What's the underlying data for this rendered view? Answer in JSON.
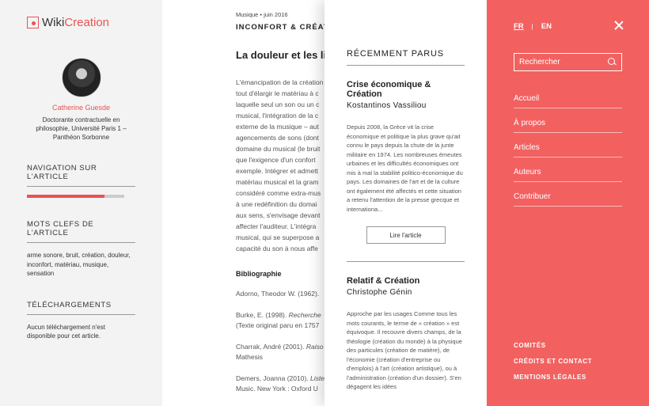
{
  "sidebar": {
    "logo": {
      "word1": "Wiki",
      "word2": "Creation"
    },
    "author": {
      "name": "Catherine Guesde",
      "description": "Doctorante contractuelle en philosophie, Université Paris 1 – Panthéon Sorbonne"
    },
    "navigation_title": "NAVIGATION SUR L'ARTICLE",
    "reading_progress": 0.8,
    "keywords_title": "MOTS CLEFS DE L'ARTICLE",
    "keywords": "arme sonore, bruit, création, douleur, inconfort, matériau, musique, sensation",
    "downloads_title": "TÉLÉCHARGEMENTS",
    "downloads_text": "Aucun téléchargement n'est disponible pour cet article."
  },
  "article": {
    "meta": "Musique • juin 2016",
    "rubric": "INCONFORT & CRÉATION",
    "title": "La douleur et les limites",
    "body": [
      "L'émancipation de la création",
      "tout d'élargir le matériau à c",
      "laquelle seul un son ou un c",
      "musical, l'intégration de la c",
      "externe de la musique – aut",
      "agencements de sons (dont",
      "domaine du musical (le bruit",
      "que l'exigence d'un confort",
      "exemple. Intégrer et admett",
      "matériau musical et la gram",
      "considéré comme extra-mus",
      "à une redéfinition du domai",
      "aux sens, s'envisage devant",
      "affecter l'auditeur. L'intégra",
      "musical, qui se superpose a",
      "capacité du son à nous affe"
    ],
    "bibliography_title": "Bibliographie",
    "references": [
      {
        "text": "Adorno, Theodor W. (1962).",
        "italic": "",
        "rest": ""
      },
      {
        "text": "Burke, E. (1998). ",
        "italic": "Recherche",
        "rest": "(Texte original paru en 1757"
      },
      {
        "text": "Charrak, André (2001). ",
        "italic": "Raiso",
        "rest": "Mathesis"
      },
      {
        "text": "Demers, Joanna (2010). ",
        "italic": "Liste",
        "rest": "Music. New York : Oxford U"
      }
    ]
  },
  "recent": {
    "heading": "RÉCEMMENT PARUS",
    "cards": [
      {
        "title": "Crise économique & Création",
        "author": "Kostantinos Vassiliou",
        "excerpt": "Depuis 2008, la Grèce vit la crise économique et politique la plus grave qu'ait connu le pays depuis la chute de la junte militaire en 1974. Les nombreuses émeutes urbaines et les difficultés économiques ont mis à mal la stabilité politico-économique du pays. Les domaines de l'art et de la culture ont également été affectés et cette situation a retenu l'attention de la presse grecque et internationa...",
        "button": "Lire l'article"
      },
      {
        "title": "Relatif & Création",
        "author": "Christophe Génin",
        "excerpt": "Approche par les usages Comme tous les mots courants, le terme de « création » est équivoque. Il recouvre divers champs, de la théologie (création du monde) à la physique des particules (création de matière), de l'économie (création d'entreprise ou d'emplois) à l'art (création artistique), ou à l'administration (création d'un dossier). S'en dégagent les idées"
      }
    ]
  },
  "menu": {
    "lang_fr": "FR",
    "lang_sep": "|",
    "lang_en": "EN",
    "search_placeholder": "Rechercher",
    "items": [
      "Accueil",
      "À propos",
      "Articles",
      "Auteurs",
      "Contribuer"
    ],
    "footer": [
      "COMITÉS",
      "CRÉDITS ET CONTACT",
      "MENTIONS LÉGALES"
    ],
    "accent_color": "#f26160"
  }
}
